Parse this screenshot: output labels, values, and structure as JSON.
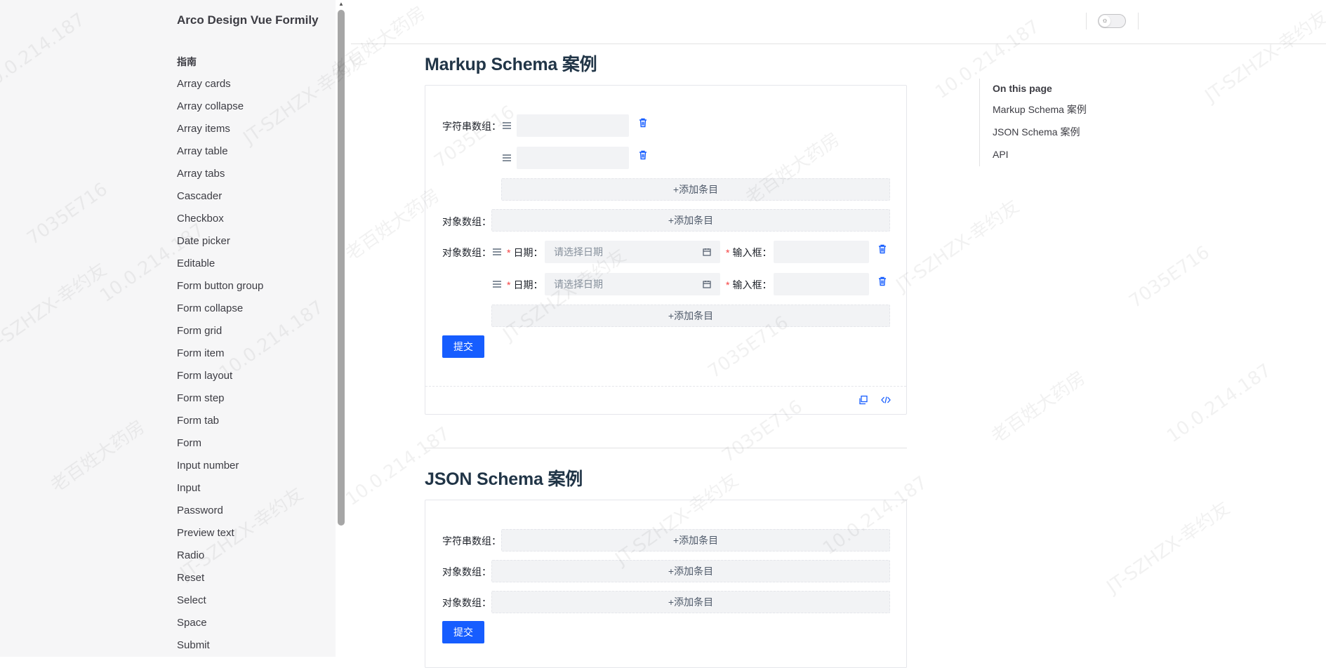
{
  "sidebar": {
    "brand": "Arco Design Vue Formily",
    "group": "指南",
    "items": [
      "Array cards",
      "Array collapse",
      "Array items",
      "Array table",
      "Array tabs",
      "Cascader",
      "Checkbox",
      "Date picker",
      "Editable",
      "Form button group",
      "Form collapse",
      "Form grid",
      "Form item",
      "Form layout",
      "Form step",
      "Form tab",
      "Form",
      "Input number",
      "Input",
      "Password",
      "Preview text",
      "Radio",
      "Reset",
      "Select",
      "Space",
      "Submit"
    ]
  },
  "topbar": {
    "theme_icon": "sun-icon"
  },
  "outline": {
    "title": "On this page",
    "items": [
      "Markup Schema 案例",
      "JSON Schema 案例",
      "API"
    ]
  },
  "markup_section": {
    "title": "Markup Schema 案例",
    "string_array_label": "字符串数组",
    "string_values": [
      "",
      ""
    ],
    "add_label": "+添加条目",
    "object_array_label": "对象数组",
    "date_label": "日期",
    "date_placeholder": "请选择日期",
    "input_label": "输入框",
    "colon": "：",
    "submit_label": "提交"
  },
  "json_section": {
    "title": "JSON Schema 案例",
    "string_array_label": "字符串数组",
    "object_array_label": "对象数组",
    "add_label": "+添加条目",
    "colon": "：",
    "submit_label": "提交"
  },
  "watermark": {
    "texts": [
      "老百姓大药房",
      "JT-SZHZX-幸约友",
      "7035E716",
      "10.0.214.187"
    ]
  },
  "colors": {
    "primary": "#165dff",
    "danger": "#f53f3f",
    "fill": "#f2f3f5"
  }
}
